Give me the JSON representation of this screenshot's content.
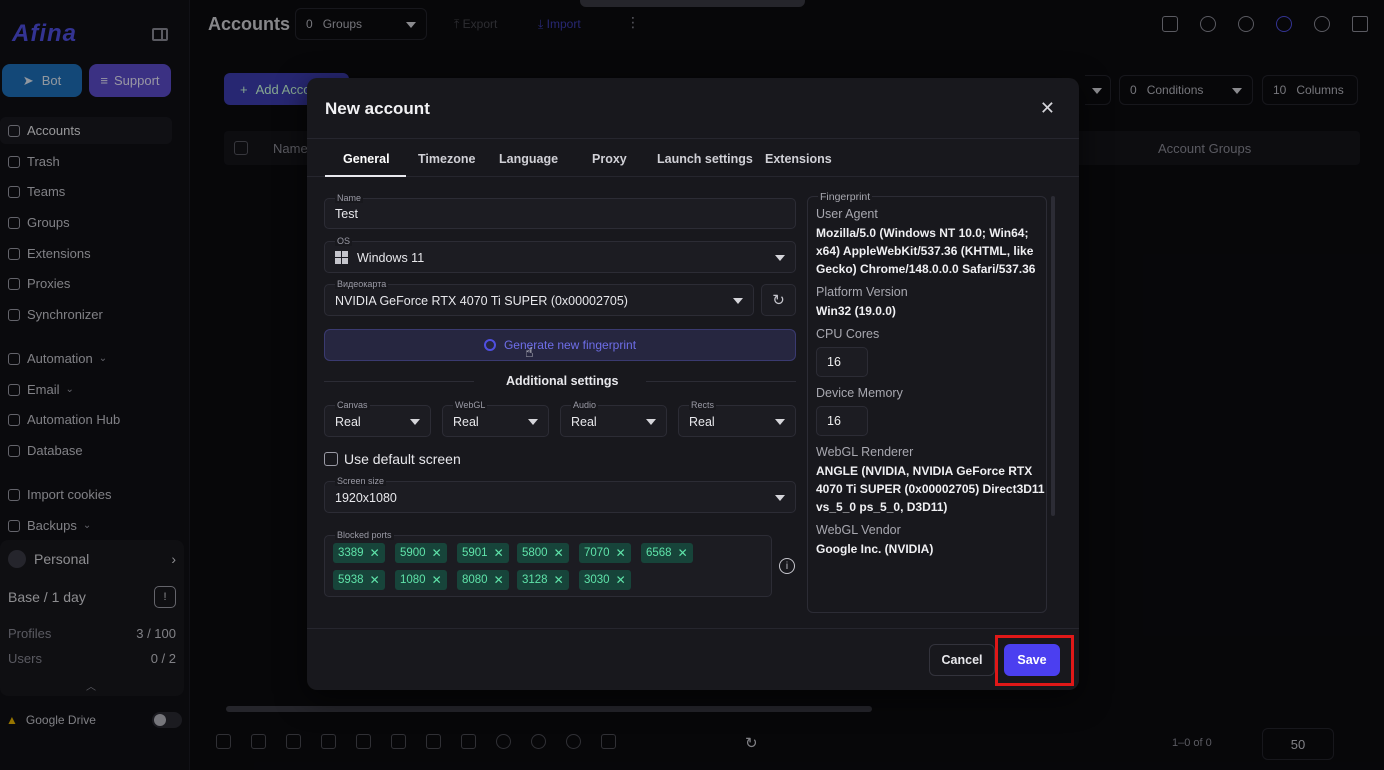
{
  "app": {
    "logo": "Afina"
  },
  "sidebar": {
    "bot_label": "Bot",
    "support_label": "Support",
    "items": [
      {
        "label": "Accounts"
      },
      {
        "label": "Trash"
      },
      {
        "label": "Teams"
      },
      {
        "label": "Groups"
      },
      {
        "label": "Extensions"
      },
      {
        "label": "Proxies"
      },
      {
        "label": "Synchronizer"
      },
      {
        "label": "Automation"
      },
      {
        "label": "Email"
      },
      {
        "label": "Automation Hub"
      },
      {
        "label": "Database"
      },
      {
        "label": "Import cookies"
      },
      {
        "label": "Backups"
      }
    ],
    "plan": {
      "workspace": "Personal",
      "tier": "Base / 1 day",
      "profiles_label": "Profiles",
      "profiles_value": "3 / 100",
      "users_label": "Users",
      "users_value": "0 / 2"
    },
    "gdrive_label": "Google Drive"
  },
  "topbar": {
    "title": "Accounts",
    "groups_count": "0",
    "groups_label": "Groups",
    "export_label": "Export",
    "import_label": "Import"
  },
  "main": {
    "add_account": "Add Accou",
    "conditions_count": "0",
    "conditions_label": "Conditions",
    "columns_count": "10",
    "columns_label": "Columns",
    "col_name": "Name",
    "col_groups": "Account Groups",
    "pagination": "1–0 of 0",
    "per_page": "50"
  },
  "modal": {
    "title": "New account",
    "tabs": [
      {
        "label": "General"
      },
      {
        "label": "Timezone"
      },
      {
        "label": "Language"
      },
      {
        "label": "Proxy"
      },
      {
        "label": "Launch settings"
      },
      {
        "label": "Extensions"
      }
    ],
    "name": {
      "label": "Name",
      "value": "Test"
    },
    "os": {
      "label": "OS",
      "value": "Windows 11"
    },
    "gpu": {
      "label": "Видеокарта",
      "value": "NVIDIA GeForce RTX 4070 Ti SUPER (0x00002705)"
    },
    "generate_label": "Generate new fingerprint",
    "additional_title": "Additional settings",
    "canvas": {
      "label": "Canvas",
      "value": "Real"
    },
    "webgl": {
      "label": "WebGL",
      "value": "Real"
    },
    "audio": {
      "label": "Audio",
      "value": "Real"
    },
    "rects": {
      "label": "Rects",
      "value": "Real"
    },
    "default_screen_label": "Use default screen",
    "screen": {
      "label": "Screen size",
      "value": "1920x1080"
    },
    "ports_label": "Blocked ports",
    "ports": [
      "3389",
      "5900",
      "5901",
      "5800",
      "7070",
      "6568",
      "5938",
      "1080",
      "8080",
      "3128",
      "3030"
    ],
    "fingerprint": {
      "title": "Fingerprint",
      "ua_label": "User Agent",
      "ua_value": "Mozilla/5.0 (Windows NT 10.0; Win64; x64) AppleWebKit/537.36 (KHTML, like Gecko) Chrome/148.0.0.0 Safari/537.36",
      "platform_label": "Platform Version",
      "platform_value": "Win32 (19.0.0)",
      "cpu_label": "CPU Cores",
      "cpu_value": "16",
      "mem_label": "Device Memory",
      "mem_value": "16",
      "renderer_label": "WebGL Renderer",
      "renderer_value": "ANGLE (NVIDIA, NVIDIA GeForce RTX 4070 Ti SUPER (0x00002705) Direct3D11 vs_5_0 ps_5_0, D3D11)",
      "vendor_label": "WebGL Vendor",
      "vendor_value": "Google Inc. (NVIDIA)"
    },
    "cancel_label": "Cancel",
    "save_label": "Save"
  },
  "colors": {
    "accent": "#4b3ff0",
    "highlight": "#e01818",
    "chip_text": "#5fe3a9"
  }
}
